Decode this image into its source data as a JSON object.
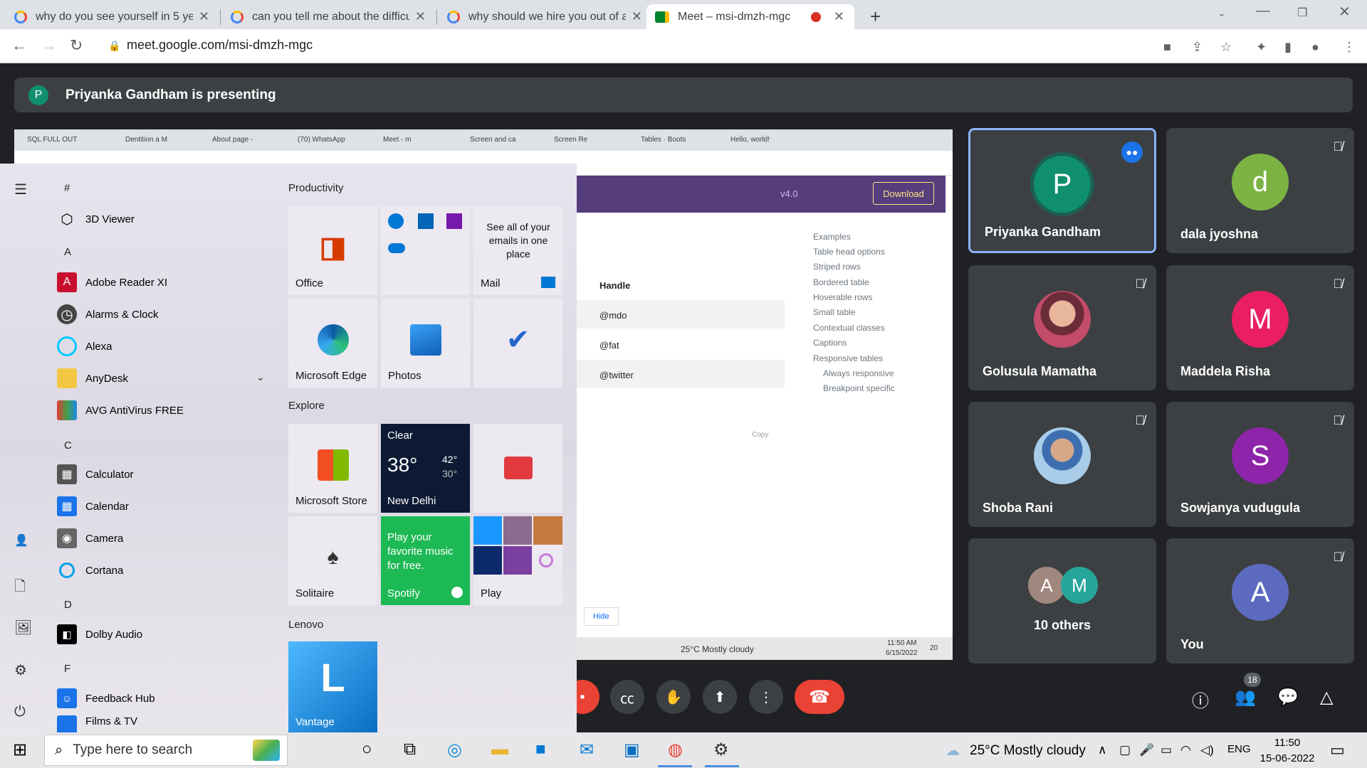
{
  "browser": {
    "tabs": [
      {
        "title": "why do you see yourself in 5 yea"
      },
      {
        "title": "can you tell me about the difficul"
      },
      {
        "title": "why should we hire you out of al"
      },
      {
        "title": "Meet – msi-dmzh-mgc"
      }
    ],
    "new_tab": "+",
    "url": "meet.google.com/msi-dmzh-mgc"
  },
  "meet": {
    "presenter_initial": "P",
    "presenting_text": "Priyanka Gandham is presenting",
    "participants": [
      {
        "name": "Priyanka Gandham",
        "initial": "P",
        "color": "#0f8f6e"
      },
      {
        "name": "dala jyoshna",
        "initial": "d",
        "color": "#7cb342"
      },
      {
        "name": "Golusula Mamatha",
        "initial": ""
      },
      {
        "name": "Maddela Risha",
        "initial": "M",
        "color": "#e91e63"
      },
      {
        "name": "Shoba Rani",
        "initial": ""
      },
      {
        "name": "Sowjanya vudugula",
        "initial": "S",
        "color": "#8e24aa"
      },
      {
        "name": "10 others",
        "initial": ""
      },
      {
        "name": "You",
        "initial": "A",
        "color": "#5c6bc0"
      }
    ],
    "others_initials": [
      "A",
      "M"
    ],
    "people_count": "18"
  },
  "shared_screen": {
    "tabs": [
      "SQL FULL OUT",
      "Dentition a M",
      "About page -",
      "(70) WhatsApp",
      "Meet - m",
      "Screen and ca",
      "Screen Re",
      "Tables · Boots",
      "Hello, world!"
    ],
    "version": "v4.0",
    "download": "Download",
    "handle_header": "Handle",
    "handles": [
      "@mdo",
      "@fat",
      "@twitter"
    ],
    "copy": "Copy",
    "hide": "Hide",
    "toc": [
      "Examples",
      "Table head options",
      "Striped rows",
      "Bordered table",
      "Hoverable rows",
      "Small table",
      "Contextual classes",
      "Captions",
      "Responsive tables",
      "Always responsive",
      "Breakpoint specific"
    ],
    "weather": "25°C  Mostly cloudy",
    "time": "11:50 AM",
    "date": "6/15/2022",
    "notif": "20"
  },
  "start_menu": {
    "headers": [
      "#",
      "A",
      "C",
      "D",
      "F"
    ],
    "apps": [
      {
        "label": "3D Viewer",
        "icon": "cube-icon"
      },
      {
        "label": "Adobe Reader XI",
        "icon": "adobe-icon"
      },
      {
        "label": "Alarms & Clock",
        "icon": "clock-icon"
      },
      {
        "label": "Alexa",
        "icon": "alexa-icon"
      },
      {
        "label": "AnyDesk",
        "icon": "folder-icon"
      },
      {
        "label": "AVG AntiVirus FREE",
        "icon": "avg-icon"
      },
      {
        "label": "Calculator",
        "icon": "calculator-icon"
      },
      {
        "label": "Calendar",
        "icon": "calendar-icon"
      },
      {
        "label": "Camera",
        "icon": "camera-icon"
      },
      {
        "label": "Cortana",
        "icon": "cortana-icon"
      },
      {
        "label": "Dolby Audio",
        "icon": "dolby-icon"
      },
      {
        "label": "Feedback Hub",
        "icon": "feedback-icon"
      },
      {
        "label": "Films & TV",
        "icon": "films-icon"
      }
    ],
    "groups": [
      "Productivity",
      "Explore",
      "Lenovo"
    ],
    "tiles": {
      "office": "Office",
      "mail_text": "See all of your emails in one place",
      "mail": "Mail",
      "edge": "Microsoft Edge",
      "photos": "Photos",
      "store": "Microsoft Store",
      "weather_cond": "Clear",
      "weather_temp": "38°",
      "weather_hi": "42°",
      "weather_lo": "30°",
      "weather_city": "New Delhi",
      "solitaire": "Solitaire",
      "spotify_text": "Play your favorite music for free.",
      "spotify": "Spotify",
      "play": "Play",
      "vantage": "Vantage"
    }
  },
  "taskbar": {
    "search_placeholder": "Type here to search",
    "weather": "25°C  Mostly cloudy",
    "lang": "ENG",
    "time": "11:50",
    "date": "15-06-2022"
  }
}
